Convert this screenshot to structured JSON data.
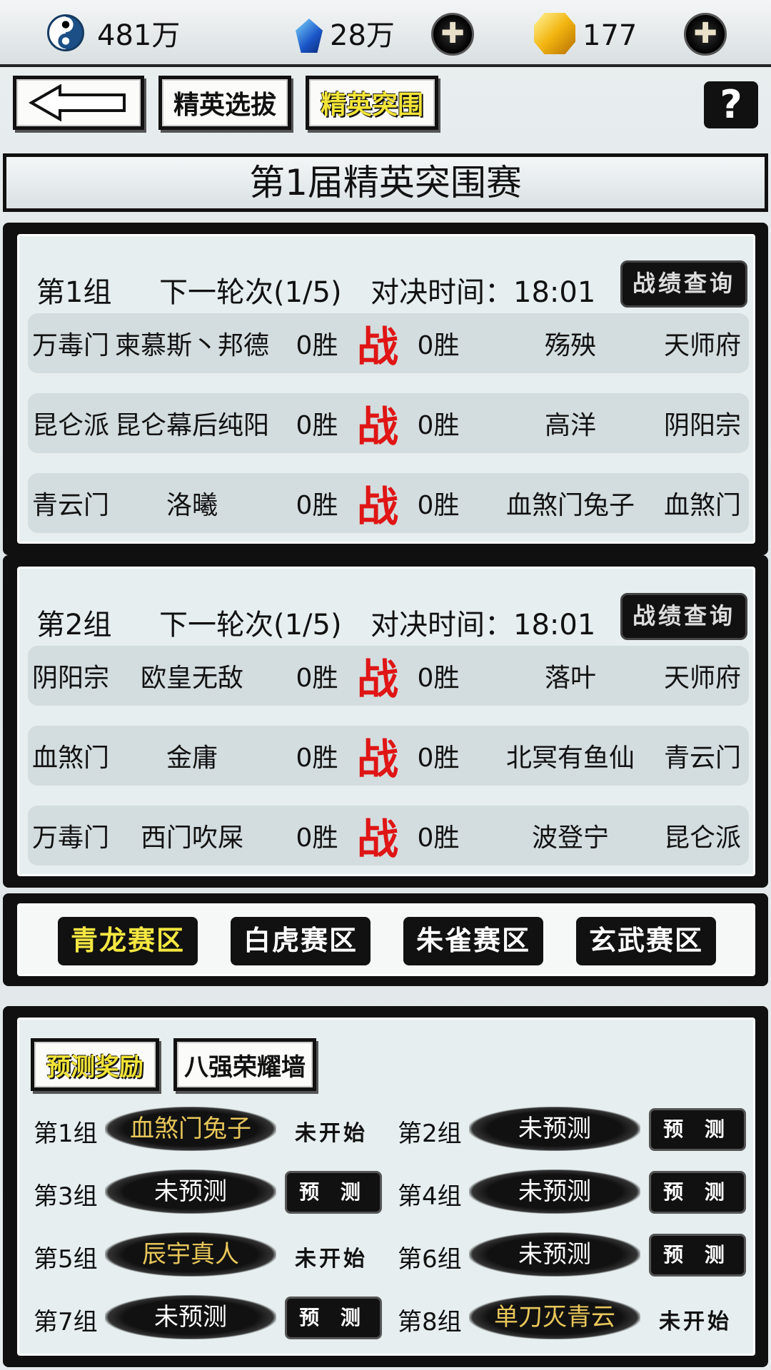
{
  "resources": {
    "taiji": "481万",
    "gem": "28万",
    "gold": "177"
  },
  "nav": {
    "select_tab": "精英选拔",
    "breakout_tab": "精英突围",
    "help": "?"
  },
  "title": "第1届精英突围赛",
  "groups": [
    {
      "name": "第1组",
      "round": "下一轮次(1/5)",
      "time": "对决时间：18:01",
      "record": "战绩查询",
      "matches": [
        {
          "sect_a": "万毒门",
          "player_a": "柬慕斯丶邦德",
          "wins_a": "0胜",
          "vs": "战",
          "wins_b": "0胜",
          "player_b": "殇殃",
          "sect_b": "天师府"
        },
        {
          "sect_a": "昆仑派",
          "player_a": "昆仑幕后纯阳",
          "wins_a": "0胜",
          "vs": "战",
          "wins_b": "0胜",
          "player_b": "高洋",
          "sect_b": "阴阳宗"
        },
        {
          "sect_a": "青云门",
          "player_a": "洛曦",
          "wins_a": "0胜",
          "vs": "战",
          "wins_b": "0胜",
          "player_b": "血煞门兔子",
          "sect_b": "血煞门"
        }
      ]
    },
    {
      "name": "第2组",
      "round": "下一轮次(1/5)",
      "time": "对决时间：18:01",
      "record": "战绩查询",
      "matches": [
        {
          "sect_a": "阴阳宗",
          "player_a": "欧皇无敌",
          "wins_a": "0胜",
          "vs": "战",
          "wins_b": "0胜",
          "player_b": "落叶",
          "sect_b": "天师府"
        },
        {
          "sect_a": "血煞门",
          "player_a": "金庸",
          "wins_a": "0胜",
          "vs": "战",
          "wins_b": "0胜",
          "player_b": "北冥有鱼仙",
          "sect_b": "青云门"
        },
        {
          "sect_a": "万毒门",
          "player_a": "西门吹屎",
          "wins_a": "0胜",
          "vs": "战",
          "wins_b": "0胜",
          "player_b": "波登宁",
          "sect_b": "昆仑派"
        }
      ]
    }
  ],
  "regions": [
    "青龙赛区",
    "白虎赛区",
    "朱雀赛区",
    "玄武赛区"
  ],
  "prediction": {
    "tab_reward": "预测奖励",
    "tab_wall": "八强荣耀墙",
    "predict_label": "预 测",
    "items": [
      {
        "group": "第1组",
        "value": "血煞门兔子",
        "status": "未开始"
      },
      {
        "group": "第2组",
        "value": "未预测",
        "status": "预 测"
      },
      {
        "group": "第3组",
        "value": "未预测",
        "status": "预 测"
      },
      {
        "group": "第4组",
        "value": "未预测",
        "status": "预 测"
      },
      {
        "group": "第5组",
        "value": "辰宇真人",
        "status": "未开始"
      },
      {
        "group": "第6组",
        "value": "未预测",
        "status": "预 测"
      },
      {
        "group": "第7组",
        "value": "未预测",
        "status": "预 测"
      },
      {
        "group": "第8组",
        "value": "单刀灭青云",
        "status": "未开始"
      }
    ]
  }
}
